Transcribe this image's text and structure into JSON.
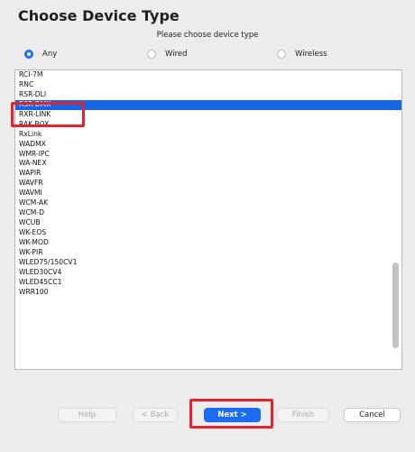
{
  "title": "Choose Device Type",
  "subtitle": "Please choose device type",
  "radios": [
    {
      "label": "Any",
      "selected": true
    },
    {
      "label": "Wired",
      "selected": false
    },
    {
      "label": "Wireless",
      "selected": false
    }
  ],
  "device_list": {
    "items": [
      "RCI-7M",
      "RNC",
      "RSR-DLI",
      "RSR-DMX",
      "RXR-LINK",
      "RAK BOX",
      "RxLink",
      "WADMX",
      "WMR-IPC",
      "WA-NEX",
      "WAPIR",
      "WAVFR",
      "WAVMI",
      "WCM-AK",
      "WCM-D",
      "WCUB",
      "WK-EOS",
      "WK-MOD",
      "WK-PIR",
      "WLED75/150CV1",
      "WLED30CV4",
      "WLED45CC1",
      "WRR100"
    ],
    "selected": "RSR-DMX"
  },
  "buttons": {
    "help": "Help",
    "back": "< Back",
    "next": "Next >",
    "finish": "Finish",
    "cancel": "Cancel"
  },
  "colors": {
    "selection": "#1565e6",
    "annotation": "#e5232c",
    "default_button": "#1b6cf2"
  }
}
